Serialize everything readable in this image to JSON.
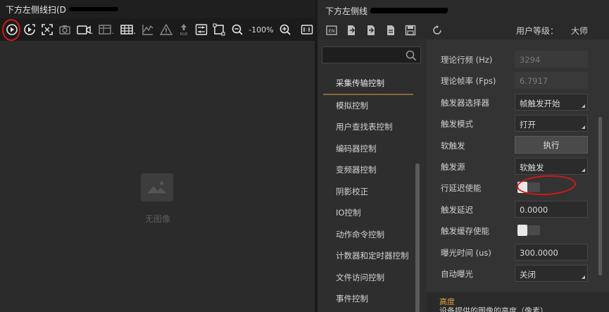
{
  "left": {
    "title": "下方左侧线扫(D",
    "zoom": "-100%",
    "no_image": "无图像"
  },
  "right": {
    "title": "下方左侧线",
    "user_level_label": "用户等级：",
    "user_level_value": "大师",
    "search": {
      "placeholder": ""
    },
    "categories": [
      "采集传输控制",
      "模拟控制",
      "用户查找表控制",
      "编码器控制",
      "变频器控制",
      "阴影校正",
      "IO控制",
      "动作命令控制",
      "计数器和定时器控制",
      "文件访问控制",
      "事件控制"
    ],
    "active_category_index": 0,
    "properties": [
      {
        "label": "理论行频 (Hz)",
        "value": "3294",
        "kind": "readonly"
      },
      {
        "label": "理论帧率 (Fps)",
        "value": "6.7917",
        "kind": "readonly"
      },
      {
        "label": "触发器选择器",
        "value": "帧触发开始",
        "kind": "dropdown"
      },
      {
        "label": "触发模式",
        "value": "打开",
        "kind": "dropdown"
      },
      {
        "label": "软触发",
        "value": "执行",
        "kind": "button"
      },
      {
        "label": "触发源",
        "value": "软触发",
        "kind": "dropdown"
      },
      {
        "label": "行延迟使能",
        "value": "",
        "kind": "toggle"
      },
      {
        "label": "触发延迟",
        "value": "0.0000",
        "kind": "text"
      },
      {
        "label": "触发缓存使能",
        "value": "",
        "kind": "toggle"
      },
      {
        "label": "曝光时间 (us)",
        "value": "300.0000",
        "kind": "text"
      },
      {
        "label": "自动曝光",
        "value": "关闭",
        "kind": "dropdown"
      }
    ],
    "description": {
      "heading": "高度",
      "text": "设备提供的图像的高度（像素）"
    }
  },
  "colors": {
    "annotation": "#d01818",
    "accent": "#e0a040"
  }
}
